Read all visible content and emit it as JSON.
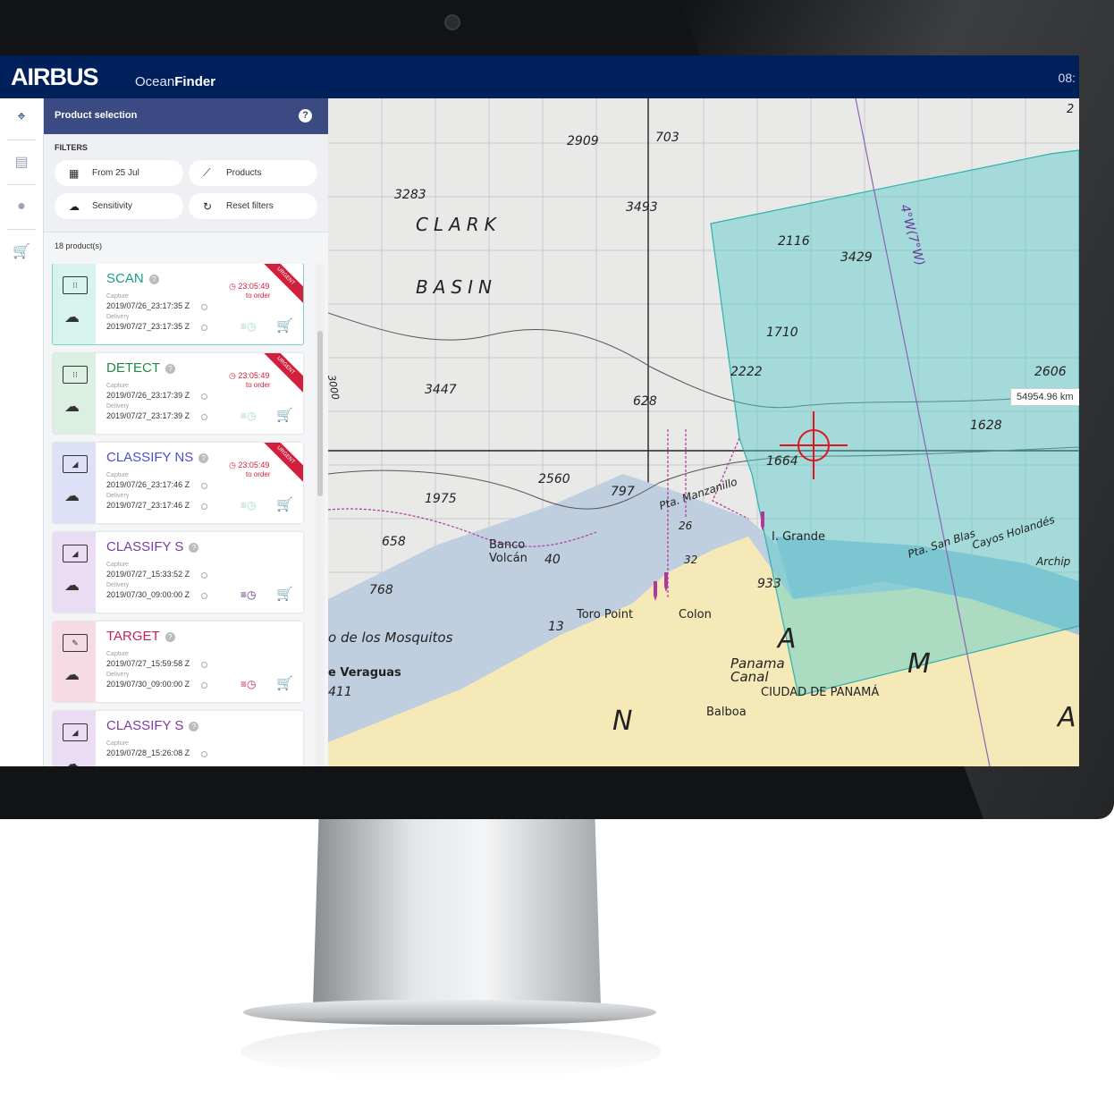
{
  "app": {
    "brand": "AIRBUS",
    "product_prefix": "Ocean",
    "product_suffix": "Finder",
    "clock": "08:"
  },
  "panel": {
    "title": "Product selection",
    "help": "?",
    "filters_title": "FILTERS",
    "filters": [
      {
        "label": "From 25 Jul",
        "icon": "calendar-icon"
      },
      {
        "label": "Products",
        "icon": "satellite-icon"
      },
      {
        "label": "Sensitivity",
        "icon": "cloud-icon"
      },
      {
        "label": "Reset filters",
        "icon": "refresh-icon"
      }
    ],
    "count": "18 product(s)"
  },
  "labels": {
    "capture": "Capture",
    "delivery": "Delivery",
    "to_order": "to order",
    "urgent": "URGENT"
  },
  "products": [
    {
      "name": "SCAN",
      "capture": "2019/07/26_23:17:35 Z",
      "delivery": "2019/07/27_23:17:35 Z",
      "timer": "23:05:49",
      "urgent": true,
      "color": "#1a9e8a",
      "side": "#d6f3ee",
      "glyph": "⁝⁝",
      "cart_color": "#1a9e8a"
    },
    {
      "name": "DETECT",
      "capture": "2019/07/26_23:17:39 Z",
      "delivery": "2019/07/27_23:17:39 Z",
      "timer": "23:05:49",
      "urgent": true,
      "color": "#1e8a45",
      "side": "#dcefe3",
      "glyph": "⁝⁝",
      "cart_color": "#1e8a45"
    },
    {
      "name": "CLASSIFY NS",
      "capture": "2019/07/26_23:17:46 Z",
      "delivery": "2019/07/27_23:17:46 Z",
      "timer": "23:05:49",
      "urgent": true,
      "color": "#4a4fd0",
      "side": "#dde0f7",
      "glyph": "◢",
      "cart_color": "#3a3fc0"
    },
    {
      "name": "CLASSIFY S",
      "capture": "2019/07/27_15:33:52 Z",
      "delivery": "2019/07/30_09:00:00 Z",
      "timer": "",
      "urgent": false,
      "color": "#7b3a9e",
      "side": "#eadcf2",
      "glyph": "◢",
      "cart_color": "#5a2a80"
    },
    {
      "name": "TARGET",
      "capture": "2019/07/27_15:59:58 Z",
      "delivery": "2019/07/30_09:00:00 Z",
      "timer": "",
      "urgent": false,
      "color": "#c0245a",
      "side": "#f6dbe4",
      "glyph": "✎",
      "cart_color": "#c0245a"
    },
    {
      "name": "CLASSIFY S",
      "capture": "2019/07/28_15:26:08 Z",
      "delivery": "",
      "timer": "",
      "urgent": false,
      "color": "#7b3a9e",
      "side": "#eadcf2",
      "glyph": "◢",
      "cart_color": "#5a2a80"
    }
  ],
  "map": {
    "soundings": [
      "2909",
      "703",
      "3283",
      "3493",
      "2116",
      "3429",
      "1710",
      "2222",
      "2606",
      "3447",
      "628",
      "1628",
      "1664",
      "2560",
      "797",
      "1975",
      "658",
      "40",
      "768",
      "933",
      "13",
      "411",
      "26",
      "32"
    ],
    "places": [
      "CLARK",
      "BASIN",
      "Banco",
      "Volcán",
      "Pta. Manzanillo",
      "I. Grande",
      "Pta. San Blas",
      "Cayos Holandés",
      "Archip",
      "Toro Point",
      "Colon",
      "o de los Mosquitos",
      "e Veraguas",
      "Panama",
      "Canal",
      "CIUDAD DE PANAMÁ",
      "Balboa",
      "A",
      "M",
      "N",
      "A",
      "3000",
      "4°W(7°W)",
      "2"
    ],
    "measure": "54954.96 km"
  },
  "colors": {
    "topbar": "#00205b",
    "panel_head": "#3b4a82",
    "urgent": "#d0203d",
    "footprint": "#4fc9c9"
  }
}
